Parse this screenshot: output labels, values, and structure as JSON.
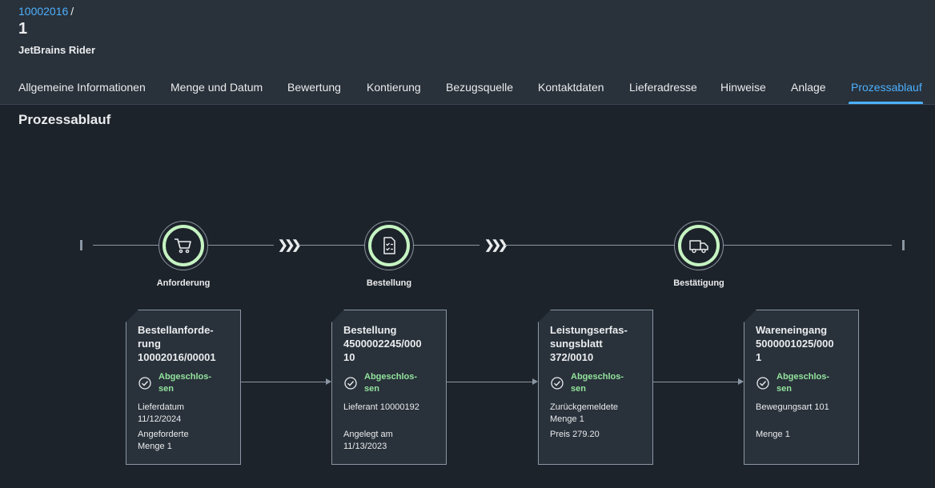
{
  "header": {
    "breadcrumb_link": "10002016",
    "breadcrumb_sep": "/",
    "title": "1",
    "subtitle": "JetBrains Rider"
  },
  "tabs": [
    {
      "label": "Allgemeine Informationen"
    },
    {
      "label": "Menge und Datum"
    },
    {
      "label": "Bewertung"
    },
    {
      "label": "Kontierung"
    },
    {
      "label": "Bezugsquelle"
    },
    {
      "label": "Kontaktdaten"
    },
    {
      "label": "Lieferadresse"
    },
    {
      "label": "Hinweise"
    },
    {
      "label": "Anlage"
    },
    {
      "label": "Prozessablauf"
    }
  ],
  "active_tab": "Prozessablauf",
  "section_title": "Prozessablauf",
  "lanes": [
    {
      "label": "Anforderung",
      "icon": "cart-icon"
    },
    {
      "label": "Bestellung",
      "icon": "document-checklist-icon"
    },
    {
      "label": "Bestätigung",
      "icon": "truck-icon"
    }
  ],
  "cards": [
    {
      "title_lines": [
        "Bestellanforde-",
        "rung",
        "10002016/00001"
      ],
      "status_lines": [
        "Abgeschlos-",
        "sen"
      ],
      "attrs": [
        "Lieferdatum",
        "11/12/2024",
        "Angeforderte",
        "Menge 1"
      ]
    },
    {
      "title_lines": [
        "Bestellung",
        "4500002245/000",
        "10"
      ],
      "status_lines": [
        "Abgeschlos-",
        "sen"
      ],
      "attrs": [
        "Lieferant 10000192",
        "Angelegt am",
        "11/13/2023"
      ]
    },
    {
      "title_lines": [
        "Leistungserfas-",
        "sungsblatt",
        "372/0010"
      ],
      "status_lines": [
        "Abgeschlos-",
        "sen"
      ],
      "attrs": [
        "Zurückgemeldete",
        "Menge 1",
        "Preis 279.20"
      ]
    },
    {
      "title_lines": [
        "Wareneingang",
        "5000001025/000",
        "1"
      ],
      "status_lines": [
        "Abgeschlos-",
        "sen"
      ],
      "attrs": [
        "Bewegungsart 101",
        "Menge 1"
      ]
    }
  ],
  "colors": {
    "accent": "#4db1ff",
    "status_positive": "#93e39d",
    "node_ring": "#c5f4c2"
  }
}
